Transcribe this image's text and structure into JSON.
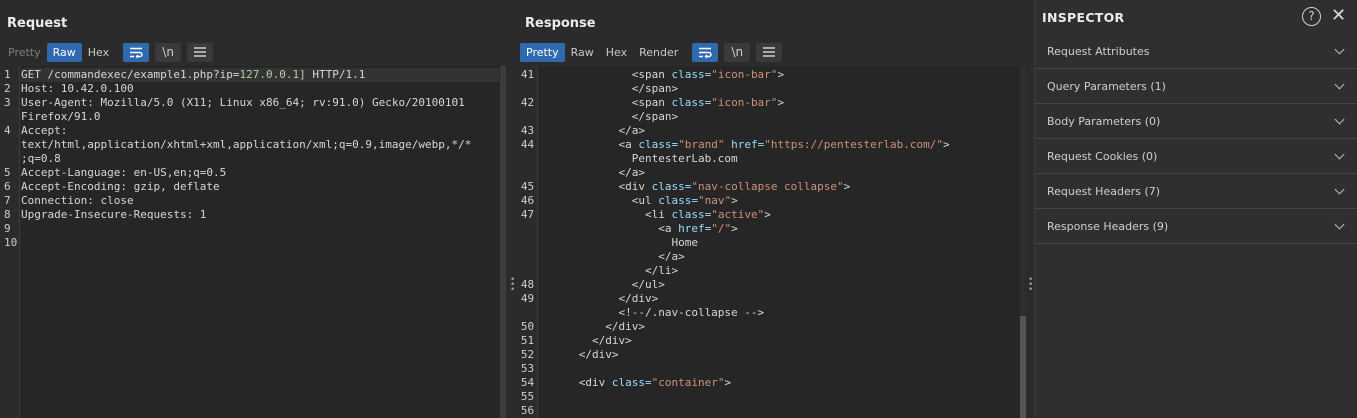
{
  "layout_toggles": [
    "side-by-side",
    "horizontal",
    "single"
  ],
  "request": {
    "title": "Request",
    "tabs": [
      "Pretty",
      "Raw",
      "Hex"
    ],
    "active_tab": "Raw",
    "icons": [
      "wrap-icon",
      "newline-icon",
      "menu-icon"
    ],
    "newline_label": "\\n",
    "lines": [
      {
        "n": "1",
        "parts": [
          {
            "t": "GET /commandexec/example1.php?ip=",
            "c": "kw"
          },
          {
            "t": "127.0.0.1]",
            "c": "hl"
          },
          {
            "t": " HTTP/1.1",
            "c": "kw"
          }
        ]
      },
      {
        "n": "2",
        "parts": [
          {
            "t": "Host: 10.42.0.100",
            "c": "kw"
          }
        ]
      },
      {
        "n": "3",
        "parts": [
          {
            "t": "User-Agent: Mozilla/5.0 (X11; Linux x86_64; rv:91.0) Gecko/20100101",
            "c": "kw"
          }
        ]
      },
      {
        "n": "",
        "parts": [
          {
            "t": "Firefox/91.0",
            "c": "kw"
          }
        ]
      },
      {
        "n": "4",
        "parts": [
          {
            "t": "Accept:",
            "c": "kw"
          }
        ]
      },
      {
        "n": "",
        "parts": [
          {
            "t": "text/html,application/xhtml+xml,application/xml;q=0.9,image/webp,*/*",
            "c": "kw"
          }
        ]
      },
      {
        "n": "",
        "parts": [
          {
            "t": ";q=0.8",
            "c": "kw"
          }
        ]
      },
      {
        "n": "5",
        "parts": [
          {
            "t": "Accept-Language: en-US,en;q=0.5",
            "c": "kw"
          }
        ]
      },
      {
        "n": "6",
        "parts": [
          {
            "t": "Accept-Encoding: gzip, deflate",
            "c": "kw"
          }
        ]
      },
      {
        "n": "7",
        "parts": [
          {
            "t": "Connection: close",
            "c": "kw"
          }
        ]
      },
      {
        "n": "8",
        "parts": [
          {
            "t": "Upgrade-Insecure-Requests: 1",
            "c": "kw"
          }
        ]
      },
      {
        "n": "9",
        "parts": [
          {
            "t": "",
            "c": "kw"
          }
        ]
      },
      {
        "n": "10",
        "parts": [
          {
            "t": "",
            "c": "kw"
          }
        ]
      }
    ]
  },
  "response": {
    "title": "Response",
    "tabs": [
      "Pretty",
      "Raw",
      "Hex",
      "Render"
    ],
    "active_tab": "Pretty",
    "icons": [
      "wrap-icon",
      "newline-icon",
      "menu-icon"
    ],
    "newline_label": "\\n",
    "lines": [
      {
        "n": "41",
        "parts": [
          {
            "t": "              <span ",
            "c": "kw"
          },
          {
            "t": "class=",
            "c": "attr"
          },
          {
            "t": "\"icon-bar\"",
            "c": "str"
          },
          {
            "t": ">",
            "c": "kw"
          }
        ]
      },
      {
        "n": "",
        "parts": [
          {
            "t": "              </span>",
            "c": "kw"
          }
        ]
      },
      {
        "n": "42",
        "parts": [
          {
            "t": "              <span ",
            "c": "kw"
          },
          {
            "t": "class=",
            "c": "attr"
          },
          {
            "t": "\"icon-bar\"",
            "c": "str"
          },
          {
            "t": ">",
            "c": "kw"
          }
        ]
      },
      {
        "n": "",
        "parts": [
          {
            "t": "              </span>",
            "c": "kw"
          }
        ]
      },
      {
        "n": "43",
        "parts": [
          {
            "t": "            </a>",
            "c": "kw"
          }
        ]
      },
      {
        "n": "44",
        "parts": [
          {
            "t": "            <a ",
            "c": "kw"
          },
          {
            "t": "class=",
            "c": "attr"
          },
          {
            "t": "\"brand\"",
            "c": "str"
          },
          {
            "t": " ",
            "c": "kw"
          },
          {
            "t": "href=",
            "c": "attr"
          },
          {
            "t": "\"https://pentesterlab.com/\"",
            "c": "str"
          },
          {
            "t": ">",
            "c": "kw"
          }
        ]
      },
      {
        "n": "",
        "parts": [
          {
            "t": "              PentesterLab.com",
            "c": "kw"
          }
        ]
      },
      {
        "n": "",
        "parts": [
          {
            "t": "            </a>",
            "c": "kw"
          }
        ]
      },
      {
        "n": "45",
        "parts": [
          {
            "t": "            <div ",
            "c": "kw"
          },
          {
            "t": "class=",
            "c": "attr"
          },
          {
            "t": "\"nav-collapse collapse\"",
            "c": "str"
          },
          {
            "t": ">",
            "c": "kw"
          }
        ]
      },
      {
        "n": "46",
        "parts": [
          {
            "t": "              <ul ",
            "c": "kw"
          },
          {
            "t": "class=",
            "c": "attr"
          },
          {
            "t": "\"nav\"",
            "c": "str"
          },
          {
            "t": ">",
            "c": "kw"
          }
        ]
      },
      {
        "n": "47",
        "parts": [
          {
            "t": "                <li ",
            "c": "kw"
          },
          {
            "t": "class=",
            "c": "attr"
          },
          {
            "t": "\"active\"",
            "c": "str"
          },
          {
            "t": ">",
            "c": "kw"
          }
        ]
      },
      {
        "n": "",
        "parts": [
          {
            "t": "                  <a ",
            "c": "kw"
          },
          {
            "t": "href=",
            "c": "attr"
          },
          {
            "t": "\"/\"",
            "c": "str"
          },
          {
            "t": ">",
            "c": "kw"
          }
        ]
      },
      {
        "n": "",
        "parts": [
          {
            "t": "                    Home",
            "c": "kw"
          }
        ]
      },
      {
        "n": "",
        "parts": [
          {
            "t": "                  </a>",
            "c": "kw"
          }
        ]
      },
      {
        "n": "",
        "parts": [
          {
            "t": "                </li>",
            "c": "kw"
          }
        ]
      },
      {
        "n": "48",
        "parts": [
          {
            "t": "              </ul>",
            "c": "kw"
          }
        ]
      },
      {
        "n": "49",
        "parts": [
          {
            "t": "            </div>",
            "c": "kw"
          }
        ]
      },
      {
        "n": "",
        "parts": [
          {
            "t": "            <!--/.nav-collapse -->",
            "c": "kw"
          }
        ]
      },
      {
        "n": "50",
        "parts": [
          {
            "t": "          </div>",
            "c": "kw"
          }
        ]
      },
      {
        "n": "51",
        "parts": [
          {
            "t": "        </div>",
            "c": "kw"
          }
        ]
      },
      {
        "n": "52",
        "parts": [
          {
            "t": "      </div>",
            "c": "kw"
          }
        ]
      },
      {
        "n": "53",
        "parts": [
          {
            "t": "",
            "c": "kw"
          }
        ]
      },
      {
        "n": "54",
        "parts": [
          {
            "t": "      <div ",
            "c": "kw"
          },
          {
            "t": "class=",
            "c": "attr"
          },
          {
            "t": "\"container\"",
            "c": "str"
          },
          {
            "t": ">",
            "c": "kw"
          }
        ]
      },
      {
        "n": "55",
        "parts": [
          {
            "t": "",
            "c": "kw"
          }
        ]
      },
      {
        "n": "56",
        "parts": [
          {
            "t": "",
            "c": "kw"
          }
        ]
      }
    ]
  },
  "inspector": {
    "title": "INSPECTOR",
    "help_label": "?",
    "close_label": "✕",
    "sections": [
      "Request Attributes",
      "Query Parameters (1)",
      "Body Parameters (0)",
      "Request Cookies (0)",
      "Request Headers (7)",
      "Response Headers (9)"
    ]
  },
  "colors": {
    "accent": "#2f6ab0",
    "background": "#2b2b2b",
    "editor_bg": "#262626",
    "string": "#ce9178",
    "attribute": "#9cdcfe",
    "highlight": "#b5cea8"
  }
}
